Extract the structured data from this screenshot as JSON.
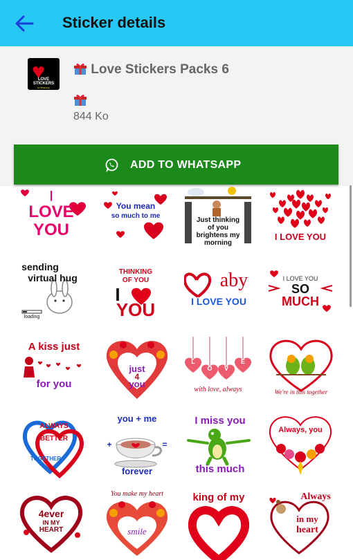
{
  "appbar": {
    "title": "Sticker details"
  },
  "pack": {
    "name": "Love Stickers Packs 6",
    "size": "844 Ko",
    "tray_label": "LOVE STICKERS",
    "tray_sub": "for WhatsApp"
  },
  "add_button": {
    "label": "ADD TO WHATSAPP"
  },
  "stickers": {
    "r1": {
      "c1": {
        "l1": "I",
        "l2": "LOVE",
        "l3": "YOU"
      },
      "c2": {
        "l1": "You mean",
        "l2": "so much to me"
      },
      "c3": {
        "l1": "Just thinking",
        "l2": "of you",
        "l3": "brightens my",
        "l4": "morning"
      },
      "c4": {
        "l1": "I LOVE YOU"
      }
    },
    "r2": {
      "c1": {
        "l1": "sending",
        "l2": "virtual hug",
        "l3": "loading"
      },
      "c2": {
        "l1": "THINKING",
        "l2": "OF YOU",
        "l3": "I",
        "l4": "YOU"
      },
      "c3": {
        "l1": "aby",
        "l2": "I LOVE YOU"
      },
      "c4": {
        "l1": "I LOVE YOU",
        "l2": "SO",
        "l3": "MUCH"
      }
    },
    "r3": {
      "c1": {
        "l1": "A kiss just",
        "l2": "for you"
      },
      "c2": {
        "l1": "just",
        "l2": "4",
        "l3": "you"
      },
      "c3": {
        "l1": "L",
        "l2": "O",
        "l3": "V",
        "l4": "E",
        "l5": "with love, always"
      },
      "c4": {
        "l1": "We're in this together"
      }
    },
    "r4": {
      "c1": {
        "l1": "ALWAYS",
        "l2": "BETTER",
        "l3": "TOGETHER"
      },
      "c2": {
        "l1": "you + me",
        "l2": "+",
        "l3": "=",
        "l4": "forever"
      },
      "c3": {
        "l1": "I miss you",
        "l2": "this much"
      },
      "c4": {
        "l1": "Always, you"
      }
    },
    "r5": {
      "c1": {
        "l1": "4ever",
        "l2": "IN MY",
        "l3": "HEART"
      },
      "c2": {
        "l1": "You make my heart",
        "l2": "smile"
      },
      "c3": {
        "l1": "king of my"
      },
      "c4": {
        "l1": "Always",
        "l2": "in my",
        "l3": "heart"
      }
    }
  },
  "colors": {
    "appbar": "#27c9f4",
    "button": "#1b8a1b",
    "header_bg": "#f3f3f3"
  },
  "icons": {
    "back": "arrow-left-icon",
    "gift": "gift-icon",
    "whatsapp": "whatsapp-icon"
  }
}
